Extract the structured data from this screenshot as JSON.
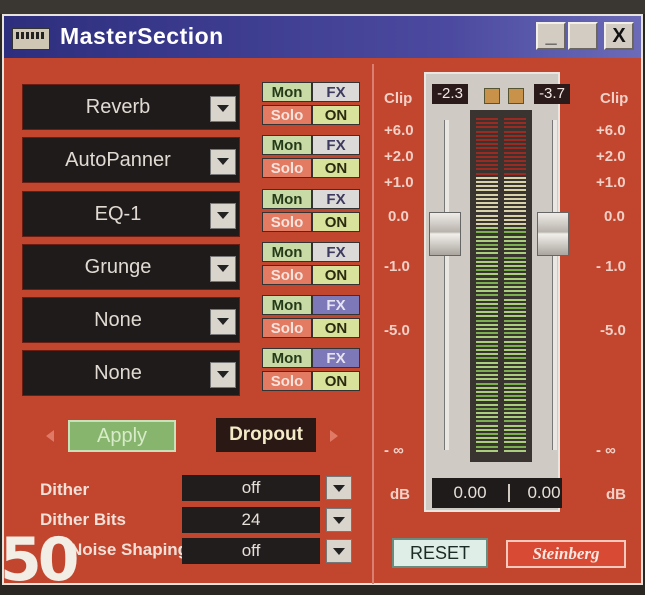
{
  "window": {
    "title": "MasterSection"
  },
  "titlebar_buttons": {
    "minimize": "_",
    "close": "X"
  },
  "effects": [
    {
      "name": "Reverb",
      "mon": "Mon",
      "fx": "FX",
      "solo": "Solo",
      "on": "ON"
    },
    {
      "name": "AutoPanner",
      "mon": "Mon",
      "fx": "FX",
      "solo": "Solo",
      "on": "ON"
    },
    {
      "name": "EQ-1",
      "mon": "Mon",
      "fx": "FX",
      "solo": "Solo",
      "on": "ON"
    },
    {
      "name": "Grunge",
      "mon": "Mon",
      "fx": "FX",
      "solo": "Solo",
      "on": "ON"
    },
    {
      "name": "None",
      "mon": "Mon",
      "fx": "FX",
      "solo": "Solo",
      "on": "ON"
    },
    {
      "name": "None",
      "mon": "Mon",
      "fx": "FX",
      "solo": "Solo",
      "on": "ON"
    }
  ],
  "apply_label": "Apply",
  "dropout_label": "Dropout",
  "dither": {
    "dither_label": "Dither",
    "dither_value": "off",
    "bits_label": "Dither Bits",
    "bits_value": "24",
    "shaping_label": "Noise Shaping",
    "shaping_value": "off"
  },
  "scale_left": {
    "clip": "Clip",
    "p6": "+6.0",
    "p2": "+2.0",
    "p1": "+1.0",
    "z": "0.0",
    "m1": "-1.0",
    "m5": "-5.0",
    "inf": "- ∞",
    "db": "dB"
  },
  "scale_right": {
    "clip": "Clip",
    "p6": "+6.0",
    "p2": "+2.0",
    "p1": "+1.0",
    "z": "0.0",
    "m1": "- 1.0",
    "m5": "-5.0",
    "inf": "- ∞",
    "db": "dB"
  },
  "meter": {
    "peak_left": "-2.3",
    "peak_right": "-3.7",
    "db_left": "0.00",
    "db_right": "0.00"
  },
  "reset_label": "RESET",
  "brand": "Steinberg",
  "page_number": "50",
  "colors": {
    "panel": "#c2452e",
    "titlebar": "#2e2e7e"
  }
}
